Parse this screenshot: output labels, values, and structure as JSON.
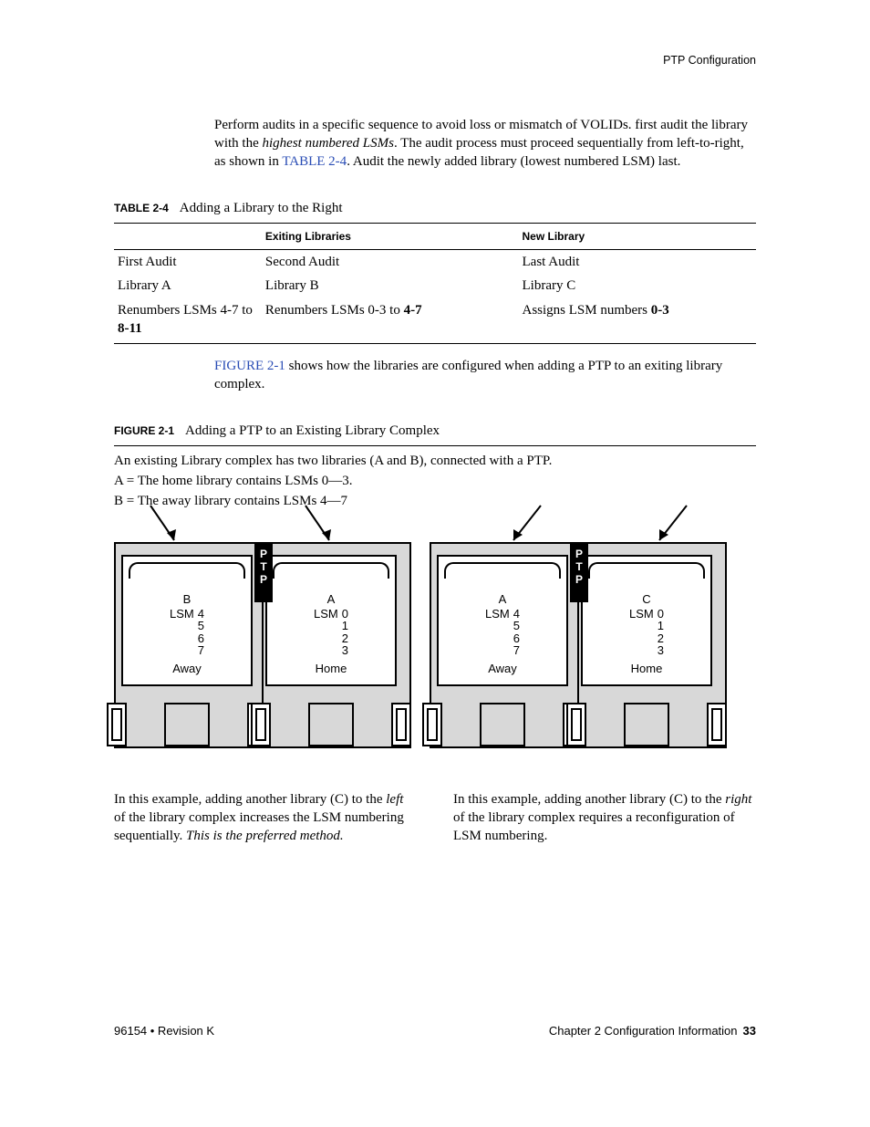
{
  "running_head": "PTP Configuration",
  "intro": {
    "p1a": "Perform audits in a specific sequence to avoid loss or mismatch of VOLIDs. first audit the library with the ",
    "p1b": "highest numbered LSMs",
    "p1c": ". The audit process must proceed sequentially from left-to-right, as shown in ",
    "p1d": "TABLE 2-4",
    "p1e": ". Audit the newly added library (lowest numbered LSM) last."
  },
  "table24": {
    "label": "TABLE 2-4",
    "title": "Adding a Library to the Right",
    "head_exiting": "Exiting Libraries",
    "head_new": "New Library",
    "r1c1": "First Audit",
    "r1c2": "Second Audit",
    "r1c3": "Last Audit",
    "r2c1": "Library A",
    "r2c2": "Library B",
    "r2c3": "Library C",
    "r3c1a": "Renumbers LSMs 4-7 to ",
    "r3c1b": "8-11",
    "r3c2a": "Renumbers LSMs 0-3 to ",
    "r3c2b": "4-7",
    "r3c3a": "Assigns LSM numbers ",
    "r3c3b": "0-3"
  },
  "after_table": {
    "a": "FIGURE 2-1",
    "b": " shows how the libraries are configured when adding a PTP to an exiting library complex."
  },
  "figure21": {
    "label": "FIGURE 2-1",
    "title": "Adding a PTP to an Existing Library Complex",
    "d1": "An existing Library complex has two libraries (A and B), connected with a PTP.",
    "d2": "A = The home library contains LSMs 0—3.",
    "d3": "B = The away library contains LSMs 4—7"
  },
  "diagram": {
    "ptp": "PTP",
    "lsm_word": "LSM",
    "left": {
      "lib1": {
        "name": "B",
        "nums": [
          "4",
          "5",
          "6",
          "7"
        ],
        "role": "Away"
      },
      "lib2": {
        "name": "A",
        "nums": [
          "0",
          "1",
          "2",
          "3"
        ],
        "role": "Home"
      }
    },
    "right": {
      "lib1": {
        "name": "A",
        "nums": [
          "4",
          "5",
          "6",
          "7"
        ],
        "role": "Away"
      },
      "lib2": {
        "name": "C",
        "nums": [
          "0",
          "1",
          "2",
          "3"
        ],
        "role": "Home"
      }
    }
  },
  "caption_left": {
    "a": "In this example, adding another library (C) to the ",
    "b": "left",
    "c": " of the library complex increases the LSM numbering sequentially. ",
    "d": "This is the preferred method."
  },
  "caption_right": {
    "a": "In this example, adding another library (C) to the ",
    "b": "right",
    "c": " of the library complex requires a reconfiguration of LSM numbering."
  },
  "footer": {
    "left": "96154 • Revision K",
    "right_a": "Chapter 2 Configuration Information",
    "right_b": "33"
  }
}
